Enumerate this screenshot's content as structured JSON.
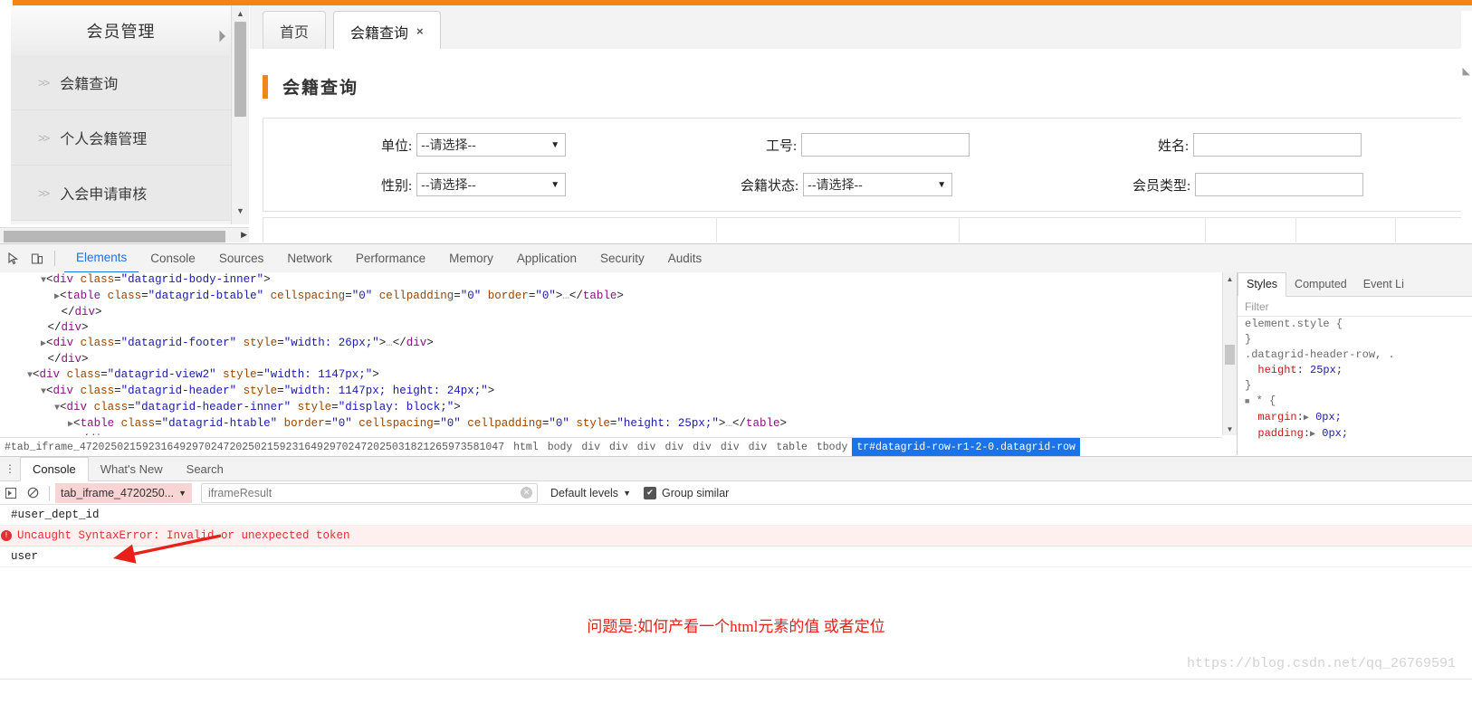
{
  "theme": {
    "accent": "#f08519",
    "devtools_blue": "#1a73e8",
    "error_red": "#e03030",
    "annotation_red": "#e8201a"
  },
  "app": {
    "sidebar": {
      "header": "会员管理",
      "items": [
        {
          "label": "会籍查询"
        },
        {
          "label": "个人会籍管理"
        },
        {
          "label": "入会申请审核"
        }
      ]
    },
    "tabs": [
      {
        "label": "首页",
        "active": false,
        "closable": false
      },
      {
        "label": "会籍查询",
        "active": true,
        "closable": true,
        "close": "×"
      }
    ],
    "page_title": "会籍查询",
    "form": {
      "fields": [
        {
          "label": "单位:",
          "type": "select",
          "value": "--请选择--"
        },
        {
          "label": "工号:",
          "type": "input",
          "value": ""
        },
        {
          "label": "姓名:",
          "type": "input",
          "value": ""
        },
        {
          "label": "性别:",
          "type": "select",
          "value": "--请选择--"
        },
        {
          "label": "会籍状态:",
          "type": "select",
          "value": "--请选择--"
        },
        {
          "label": "会员类型:",
          "type": "input",
          "value": ""
        }
      ]
    }
  },
  "devtools": {
    "toolbar": {
      "inspect_icon": "inspect-element-icon",
      "device_icon": "device-toolbar-icon",
      "tabs": [
        {
          "label": "Elements",
          "active": true
        },
        {
          "label": "Console",
          "active": false
        },
        {
          "label": "Sources",
          "active": false
        },
        {
          "label": "Network",
          "active": false
        },
        {
          "label": "Performance",
          "active": false
        },
        {
          "label": "Memory",
          "active": false
        },
        {
          "label": "Application",
          "active": false
        },
        {
          "label": "Security",
          "active": false
        },
        {
          "label": "Audits",
          "active": false
        }
      ]
    },
    "dom_lines": [
      {
        "indent": 3,
        "tri": "▼",
        "html": "&lt;<span class=\"tw\">div</span> <span class=\"at\">class</span>=<span class=\"av\">\"datagrid-body-inner\"</span>&gt;"
      },
      {
        "indent": 4,
        "tri": "▶",
        "html": "&lt;<span class=\"tw\">table</span> <span class=\"at\">class</span>=<span class=\"av\">\"datagrid-btable\"</span> <span class=\"at\">cellspacing</span>=<span class=\"av\">\"0\"</span> <span class=\"at\">cellpadding</span>=<span class=\"av\">\"0\"</span> <span class=\"at\">border</span>=<span class=\"av\">\"0\"</span>&gt;<span class=\"pk\">…</span>&lt;/<span class=\"tw\">table</span>&gt;"
      },
      {
        "indent": 4,
        "tri": "",
        "html": "&lt;/<span class=\"tw\">div</span>&gt;"
      },
      {
        "indent": 3,
        "tri": "",
        "html": "&lt;/<span class=\"tw\">div</span>&gt;"
      },
      {
        "indent": 3,
        "tri": "▶",
        "html": "&lt;<span class=\"tw\">div</span> <span class=\"at\">class</span>=<span class=\"av\">\"datagrid-footer\"</span> <span class=\"at\">style</span>=<span class=\"av\">\"width: 26px;\"</span>&gt;<span class=\"pk\">…</span>&lt;/<span class=\"tw\">div</span>&gt;"
      },
      {
        "indent": 3,
        "tri": "",
        "html": "&lt;/<span class=\"tw\">div</span>&gt;"
      },
      {
        "indent": 2,
        "tri": "▼",
        "html": "&lt;<span class=\"tw\">div</span> <span class=\"at\">class</span>=<span class=\"av\">\"datagrid-view2\"</span> <span class=\"at\">style</span>=<span class=\"av\">\"width: 1147px;\"</span>&gt;"
      },
      {
        "indent": 3,
        "tri": "▼",
        "html": "&lt;<span class=\"tw\">div</span> <span class=\"at\">class</span>=<span class=\"av\">\"datagrid-header\"</span> <span class=\"at\">style</span>=<span class=\"av\">\"width: 1147px; height: 24px;\"</span>&gt;"
      },
      {
        "indent": 4,
        "tri": "▼",
        "html": "&lt;<span class=\"tw\">div</span> <span class=\"at\">class</span>=<span class=\"av\">\"datagrid-header-inner\"</span> <span class=\"at\">style</span>=<span class=\"av\">\"display: block;\"</span>&gt;"
      },
      {
        "indent": 5,
        "tri": "▶",
        "html": "&lt;<span class=\"tw\">table</span> <span class=\"at\">class</span>=<span class=\"av\">\"datagrid-htable\"</span> <span class=\"at\">border</span>=<span class=\"av\">\"0\"</span> <span class=\"at\">cellspacing</span>=<span class=\"av\">\"0\"</span> <span class=\"at\">cellpadding</span>=<span class=\"av\">\"0\"</span> <span class=\"at\">style</span>=<span class=\"av\">\"height: 25px;\"</span>&gt;<span class=\"pk\">…</span>&lt;/<span class=\"tw\">table</span>&gt;"
      },
      {
        "indent": 5,
        "tri": "",
        "html": "&lt;/<span class=\"tw\">div</span>&gt;"
      },
      {
        "indent": 5,
        "tri": "",
        "html": "<span class=\"pk\">…</span>"
      }
    ],
    "breadcrumb": [
      {
        "label": "#tab_iframe_47202502159231649297024720250215923164929702472025031821265973581047",
        "selected": false
      },
      {
        "label": "html",
        "selected": false
      },
      {
        "label": "body",
        "selected": false
      },
      {
        "label": "div",
        "selected": false
      },
      {
        "label": "div",
        "selected": false
      },
      {
        "label": "div",
        "selected": false
      },
      {
        "label": "div",
        "selected": false
      },
      {
        "label": "div",
        "selected": false
      },
      {
        "label": "div",
        "selected": false
      },
      {
        "label": "div",
        "selected": false
      },
      {
        "label": "table",
        "selected": false
      },
      {
        "label": "tbody",
        "selected": false
      },
      {
        "label": "tr#datagrid-row-r1-2-0.datagrid-row",
        "selected": true
      }
    ],
    "styles": {
      "tabs": [
        {
          "label": "Styles",
          "active": true
        },
        {
          "label": "Computed",
          "active": false
        },
        {
          "label": "Event Li",
          "active": false
        }
      ],
      "filter_placeholder": "Filter",
      "rules": [
        {
          "selector": "element.style {",
          "props": [],
          "close": "}"
        },
        {
          "selector": ".datagrid-header-row, .",
          "props": [
            {
              "name": "height",
              "value": "25px;"
            }
          ],
          "close": "}"
        },
        {
          "selector": "* {",
          "props": [
            {
              "name": "margin",
              "value": "0px;"
            },
            {
              "name": "padding",
              "value": "0px;"
            }
          ],
          "close": ""
        }
      ]
    },
    "drawer": {
      "tabs": [
        {
          "label": "Console",
          "active": true
        },
        {
          "label": "What's New",
          "active": false
        },
        {
          "label": "Search",
          "active": false
        }
      ],
      "filters": {
        "execute_icon": "execute-toggle-icon",
        "clear_icon": "clear-console-icon",
        "context": "tab_iframe_4720250...",
        "filter_value": "iframeResult",
        "clear_filter_icon": "clear-input-icon",
        "levels": "Default levels",
        "group_similar": "Group similar",
        "group_similar_checked": true
      },
      "messages": [
        {
          "text": "#user_dept_id",
          "type": "log"
        },
        {
          "text": "Uncaught SyntaxError: Invalid or unexpected token",
          "type": "error",
          "badge": "!"
        },
        {
          "text": "user",
          "type": "log"
        }
      ]
    }
  },
  "annotation": {
    "text": "问题是:如何产看一个html元素的值 或者定位",
    "arrow": "red-arrow-pointing-to-context-selector"
  },
  "watermark": "https://blog.csdn.net/qq_26769591"
}
